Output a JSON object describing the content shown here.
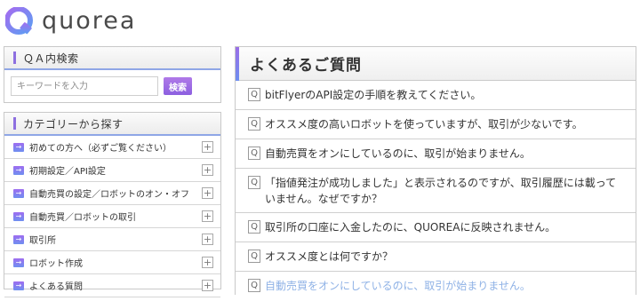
{
  "brand": {
    "logo_icon": "q-logo-icon",
    "name": "quorea"
  },
  "search": {
    "heading": "ＱＡ内検索",
    "placeholder": "キーワードを入力",
    "button_label": "検索"
  },
  "categories": {
    "heading": "カテゴリーから探す",
    "items": [
      {
        "label": "初めての方へ（必ずご覧ください）",
        "icon": "arrow-right-icon",
        "toggle": "+"
      },
      {
        "label": "初期設定／API設定",
        "icon": "arrow-right-icon",
        "toggle": "+"
      },
      {
        "label": "自動売買の設定／ロボットのオン・オフ",
        "icon": "arrow-right-icon",
        "toggle": "+"
      },
      {
        "label": "自動売買／ロボットの取引",
        "icon": "arrow-right-icon",
        "toggle": "+"
      },
      {
        "label": "取引所",
        "icon": "arrow-right-icon",
        "toggle": "+"
      },
      {
        "label": "ロボット作成",
        "icon": "arrow-right-icon",
        "toggle": "+"
      },
      {
        "label": "よくある質問",
        "icon": "arrow-right-icon",
        "toggle": "+"
      }
    ]
  },
  "faq": {
    "heading": "よくあるご質問",
    "q_mark": "Q",
    "items": [
      {
        "text": "bitFlyerのAPI設定の手順を教えてください。"
      },
      {
        "text": "オススメ度の高いロボットを使っていますが、取引が少ないです。"
      },
      {
        "text": "自動売買をオンにしているのに、取引が始まりません。"
      },
      {
        "text": "「指値発注が成功しました」と表示されるのですが、取引履歴には載っていません。なぜですか？"
      },
      {
        "text": "取引所の口座に入金したのに、QUOREAに反映されません。"
      },
      {
        "text": "オススメ度とは何ですか？"
      },
      {
        "text": "自動売買をオンにしているのに、取引が始まりません。"
      }
    ]
  }
}
